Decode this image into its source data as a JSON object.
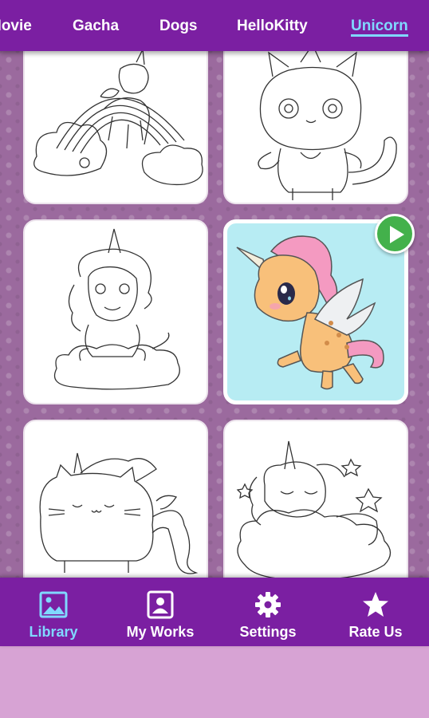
{
  "tabs": [
    {
      "label": "Movie",
      "active": false
    },
    {
      "label": "Gacha",
      "active": false
    },
    {
      "label": "Dogs",
      "active": false
    },
    {
      "label": "HelloKitty",
      "active": false
    },
    {
      "label": "Unicorn",
      "active": true
    }
  ],
  "gallery": {
    "items": [
      {
        "name": "unicorn-rainbow",
        "colored": false
      },
      {
        "name": "unicorn-kitty",
        "colored": false
      },
      {
        "name": "unicorn-cloud",
        "colored": false
      },
      {
        "name": "unicorn-pegasus",
        "colored": true,
        "has_play": true
      },
      {
        "name": "pusheen-unicorn",
        "colored": false
      },
      {
        "name": "sleeping-unicorn",
        "colored": false
      }
    ]
  },
  "bottom_nav": [
    {
      "label": "Library",
      "icon": "image-icon",
      "active": true
    },
    {
      "label": "My Works",
      "icon": "portrait-icon",
      "active": false
    },
    {
      "label": "Settings",
      "icon": "gear-icon",
      "active": false
    },
    {
      "label": "Rate Us",
      "icon": "star-icon",
      "active": false
    }
  ],
  "colors": {
    "primary": "#7b1fa2",
    "active_tab": "#80d8ff",
    "background": "#d7a3d4",
    "play_button": "#43b14b"
  }
}
